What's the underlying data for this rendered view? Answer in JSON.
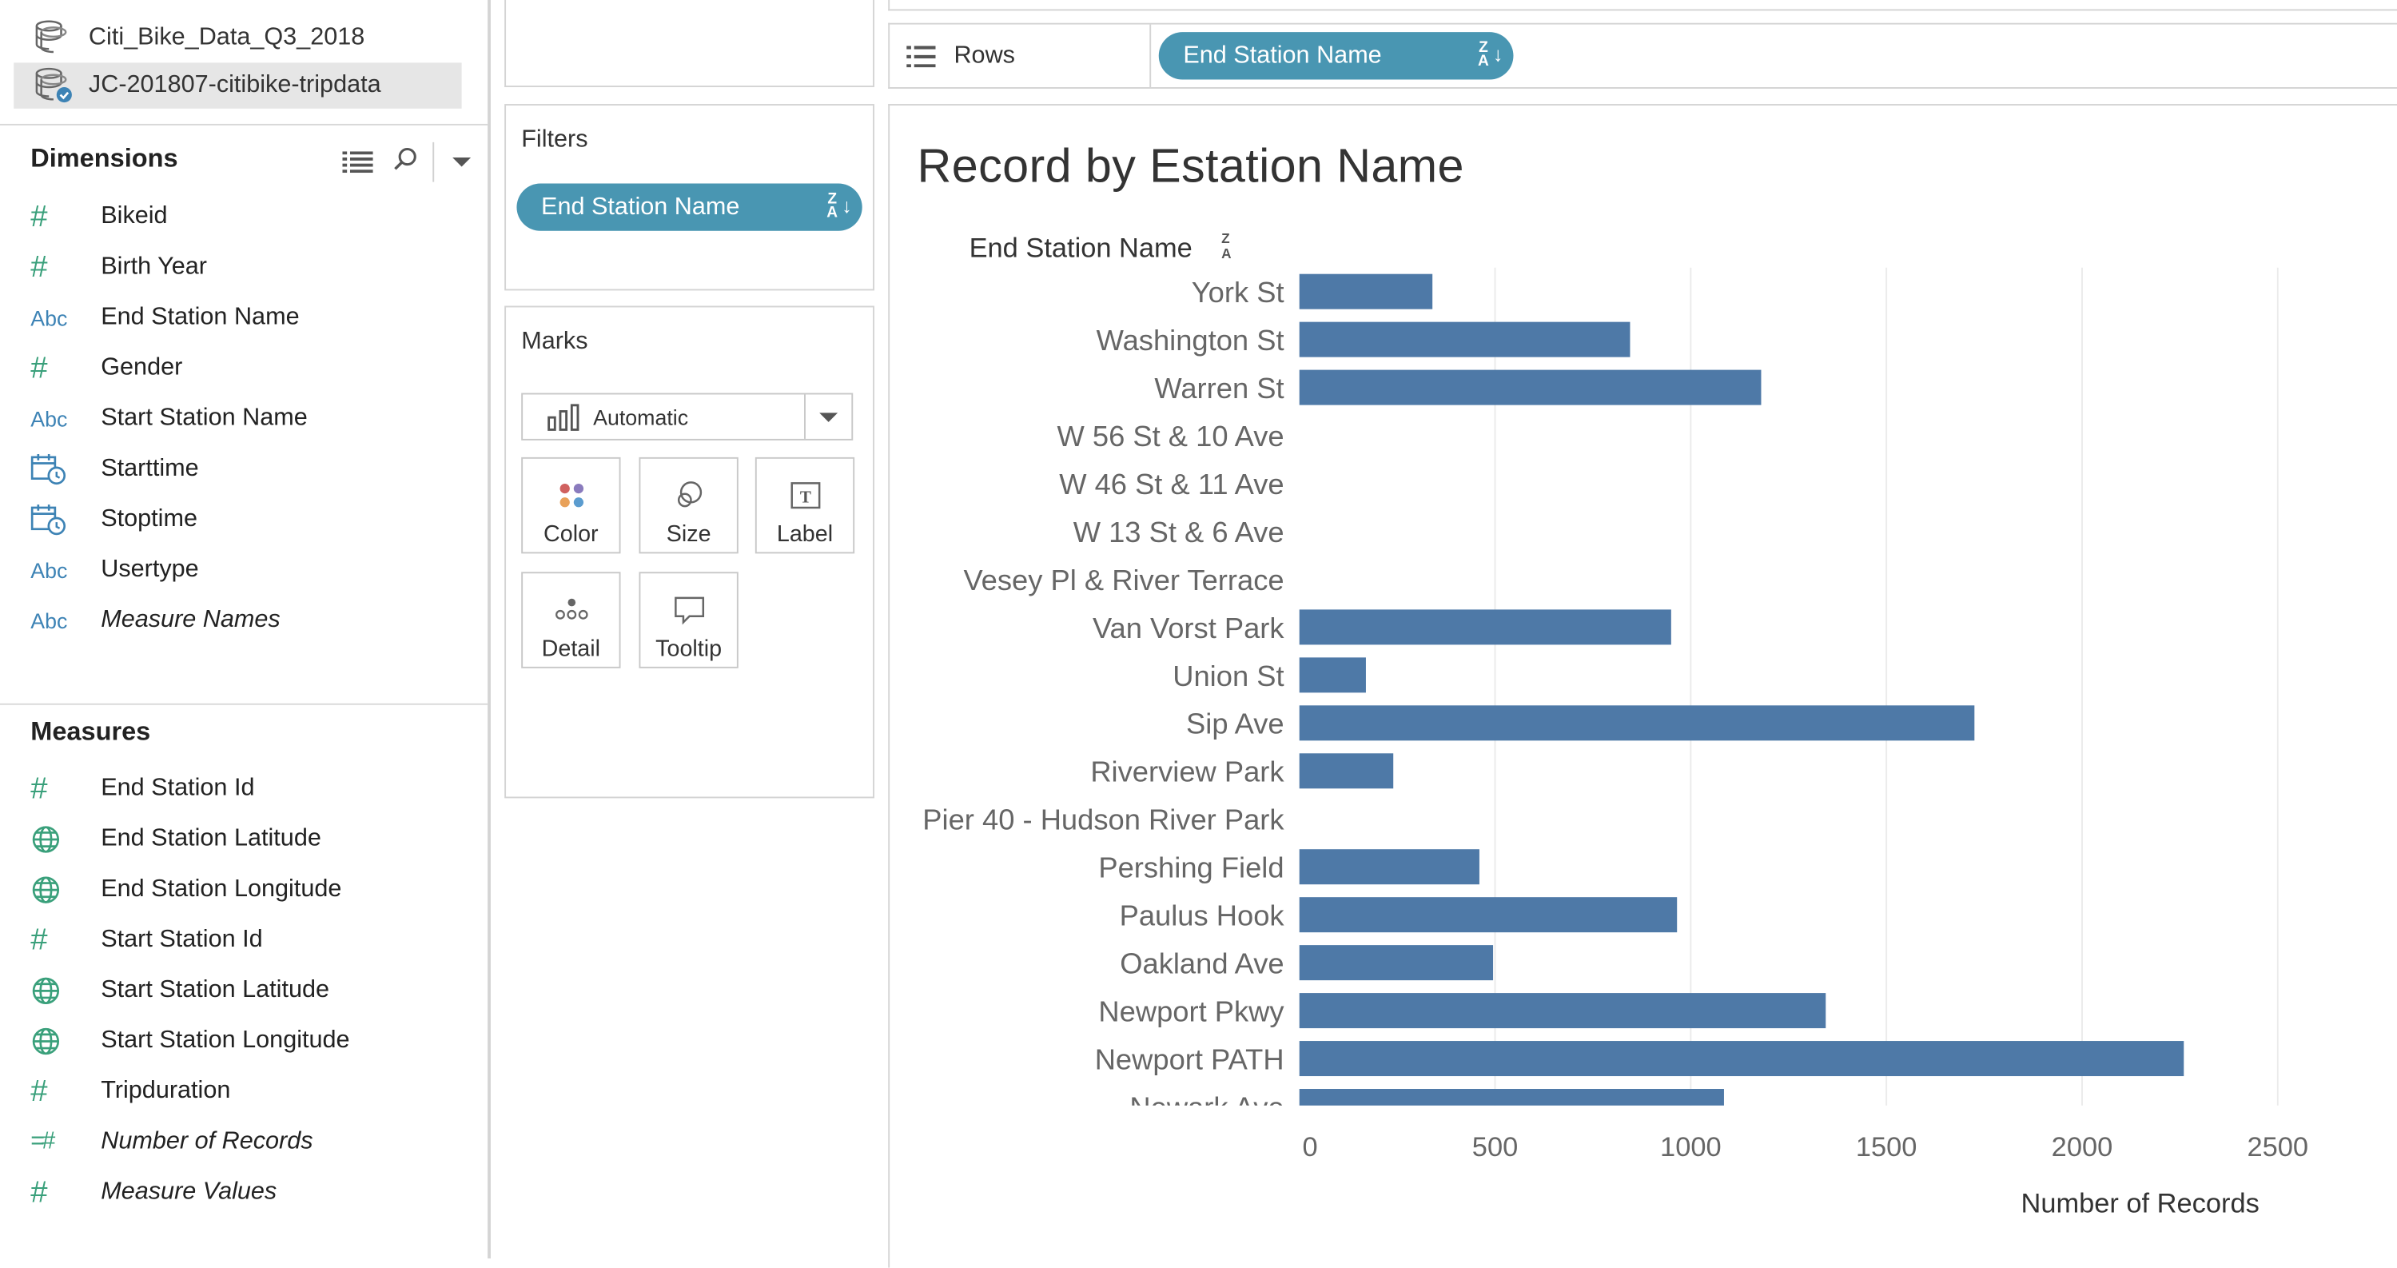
{
  "data_sources": [
    {
      "name": "Citi_Bike_Data_Q3_2018",
      "selected": false
    },
    {
      "name": "JC-201807-citibike-tripdata",
      "selected": true
    }
  ],
  "dimensions": {
    "title": "Dimensions",
    "fields": [
      {
        "type": "#",
        "label": "Bikeid",
        "italic": false
      },
      {
        "type": "#",
        "label": "Birth Year",
        "italic": false
      },
      {
        "type": "Abc",
        "label": "End Station Name",
        "italic": false
      },
      {
        "type": "#",
        "label": "Gender",
        "italic": false
      },
      {
        "type": "Abc",
        "label": "Start Station Name",
        "italic": false
      },
      {
        "type": "date",
        "label": "Starttime",
        "italic": false
      },
      {
        "type": "date",
        "label": "Stoptime",
        "italic": false
      },
      {
        "type": "Abc",
        "label": "Usertype",
        "italic": false
      },
      {
        "type": "Abc",
        "label": "Measure Names",
        "italic": true
      }
    ]
  },
  "measures": {
    "title": "Measures",
    "fields": [
      {
        "type": "#",
        "label": "End Station Id",
        "italic": false
      },
      {
        "type": "geo",
        "label": "End Station Latitude",
        "italic": false
      },
      {
        "type": "geo",
        "label": "End Station Longitude",
        "italic": false
      },
      {
        "type": "#",
        "label": "Start Station Id",
        "italic": false
      },
      {
        "type": "geo",
        "label": "Start Station Latitude",
        "italic": false
      },
      {
        "type": "geo",
        "label": "Start Station Longitude",
        "italic": false
      },
      {
        "type": "#",
        "label": "Tripduration",
        "italic": false
      },
      {
        "type": "=#",
        "label": "Number of Records",
        "italic": true
      },
      {
        "type": "#",
        "label": "Measure Values",
        "italic": true
      }
    ]
  },
  "filters": {
    "title": "Filters",
    "pill": "End Station Name",
    "sort_glyph": "Z↓A"
  },
  "marks": {
    "title": "Marks",
    "mark_type": "Automatic",
    "buttons": [
      "Color",
      "Size",
      "Label",
      "Detail",
      "Tooltip"
    ]
  },
  "rows_shelf": {
    "label": "Rows",
    "pill": "End Station Name"
  },
  "view": {
    "title": "Record by Estation Name"
  },
  "colors": {
    "accent": "#4996b2",
    "bar": "#4e79a7",
    "field_green": "#3aa07b",
    "field_blue": "#3d83b5"
  },
  "chart_data": {
    "type": "bar",
    "orientation": "horizontal",
    "title": "Record by Estation Name",
    "row_header": "End Station Name",
    "xlabel": "Number of Records",
    "xlim": [
      0,
      3500
    ],
    "xticks": [
      0,
      500,
      1000,
      1500,
      2000,
      2500,
      3000,
      3500
    ],
    "grid": true,
    "categories": [
      "York St",
      "Washington St",
      "Warren St",
      "W 56 St & 10 Ave",
      "W 46 St & 11 Ave",
      "W 13 St & 6 Ave",
      "Vesey Pl & River Terrace",
      "Van Vorst Park",
      "Union St",
      "Sip Ave",
      "Riverview Park",
      "Pier 40 - Hudson River Park",
      "Pershing Field",
      "Paulus Hook",
      "Oakland Ave",
      "Newport Pkwy",
      "Newport PATH",
      "Newark Ave"
    ],
    "values": [
      340,
      845,
      1180,
      0,
      0,
      0,
      0,
      950,
      170,
      1725,
      240,
      0,
      460,
      965,
      495,
      1345,
      2260,
      1085
    ]
  }
}
